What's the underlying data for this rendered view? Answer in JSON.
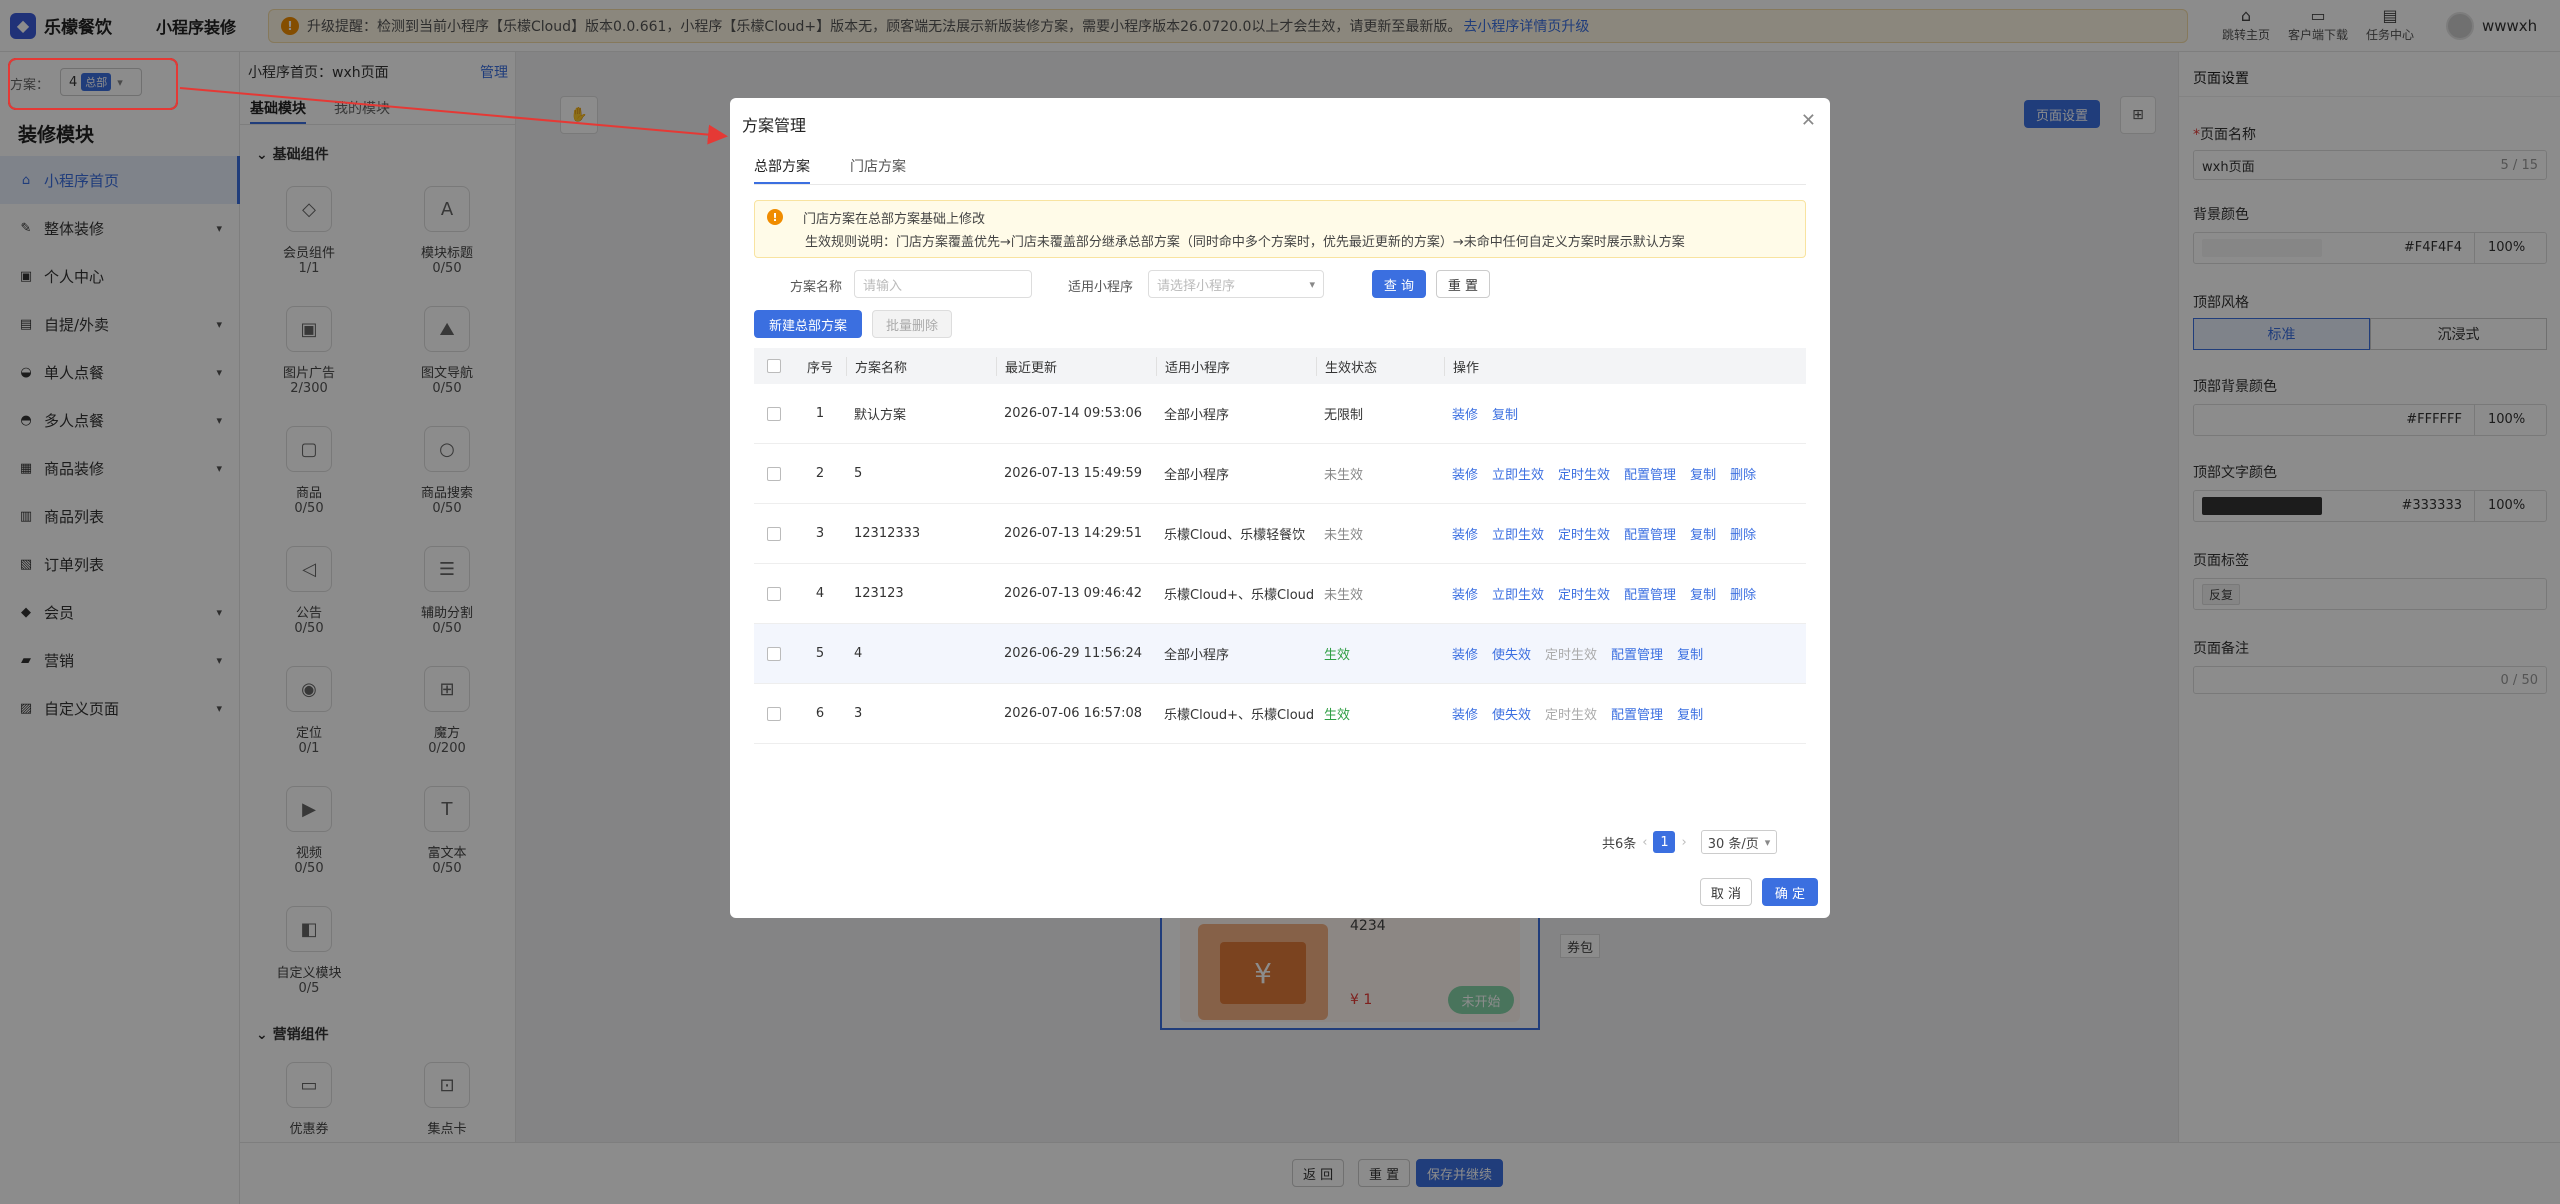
{
  "topbar": {
    "logo": "乐檬餐饮",
    "app_title": "小程序装修",
    "notice_text": "升级提醒：检测到当前小程序【乐檬Cloud】版本0.0.661，小程序【乐檬Cloud+】版本无，顾客端无法展示新版装修方案，需要小程序版本26.0720.0以上才会生效，请更新至最新版。",
    "notice_link": "去小程序详情页升级",
    "icons": [
      {
        "label": "跳转主页",
        "icon": "home-icon"
      },
      {
        "label": "客户端下载",
        "icon": "download-icon"
      },
      {
        "label": "任务中心",
        "icon": "task-icon"
      }
    ],
    "user_name": "wwwxh"
  },
  "sidebar": {
    "scheme_label": "方案：",
    "scheme_value": "4",
    "scheme_tag": "总部",
    "title": "装修模块",
    "items": [
      {
        "label": "小程序首页",
        "active": true,
        "has_children": false
      },
      {
        "label": "整体装修",
        "has_children": true
      },
      {
        "label": "个人中心",
        "has_children": false
      },
      {
        "label": "自提/外卖",
        "has_children": true
      },
      {
        "label": "单人点餐",
        "has_children": true
      },
      {
        "label": "多人点餐",
        "has_children": true
      },
      {
        "label": "商品装修",
        "has_children": true
      },
      {
        "label": "商品列表",
        "has_children": false
      },
      {
        "label": "订单列表",
        "has_children": false
      },
      {
        "label": "会员",
        "has_children": true
      },
      {
        "label": "营销",
        "has_children": true
      },
      {
        "label": "自定义页面",
        "has_children": true
      }
    ]
  },
  "components": {
    "page_label": "小程序首页：wxh页面",
    "manage": "管理",
    "tabs": [
      "基础模块",
      "我的模块"
    ],
    "group_basic": "基础组件",
    "group_marketing": "营销组件",
    "basic": [
      {
        "name": "会员组件",
        "count": "1/1"
      },
      {
        "name": "模块标题",
        "count": "0/50"
      },
      {
        "name": "图片广告",
        "count": "2/300"
      },
      {
        "name": "图文导航",
        "count": "0/50"
      },
      {
        "name": "商品",
        "count": "0/50"
      },
      {
        "name": "商品搜索",
        "count": "0/50"
      },
      {
        "name": "公告",
        "count": "0/50"
      },
      {
        "name": "辅助分割",
        "count": "0/50"
      },
      {
        "name": "定位",
        "count": "0/1"
      },
      {
        "name": "魔方",
        "count": "0/200"
      },
      {
        "name": "视频",
        "count": "0/50"
      },
      {
        "name": "富文本",
        "count": "0/50"
      },
      {
        "name": "自定义模块",
        "count": "0/5"
      }
    ],
    "marketing": [
      {
        "name": "优惠券"
      },
      {
        "name": "集点卡"
      }
    ]
  },
  "canvas": {
    "page_settings_btn": "页面设置",
    "coupon_num": "4234",
    "coupon_price": "¥ 1",
    "coupon_btn": "未开始",
    "coupon_tag": "券包"
  },
  "bottombar": {
    "back": "返 回",
    "reset": "重 置",
    "save": "保存并继续"
  },
  "right_panel": {
    "title": "页面设置",
    "page_name_label": "页面名称",
    "page_name_value": "wxh页面",
    "page_name_count": "5 / 15",
    "bg_color_label": "背景颜色",
    "bg_color_hex": "#F4F4F4",
    "bg_color_pct": "100%",
    "top_style_label": "顶部风格",
    "top_style_options": [
      "标准",
      "沉浸式"
    ],
    "top_bg_label": "顶部背景颜色",
    "top_bg_hex": "#FFFFFF",
    "top_bg_pct": "100%",
    "top_text_label": "顶部文字颜色",
    "top_text_hex": "#333333",
    "top_text_pct": "100%",
    "tag_label": "页面标签",
    "tag_value": "反复",
    "note_label": "页面备注",
    "note_count": "0 / 50"
  },
  "modal": {
    "title": "方案管理",
    "tabs": [
      "总部方案",
      "门店方案"
    ],
    "notice_l1": "门店方案在总部方案基础上修改",
    "notice_l2": "生效规则说明：门店方案覆盖优先→门店未覆盖部分继承总部方案（同时命中多个方案时，优先最近更新的方案）→未命中任何自定义方案时展示默认方案",
    "filter_name_label": "方案名称",
    "filter_name_placeholder": "请输入",
    "filter_app_label": "适用小程序",
    "filter_app_placeholder": "请选择小程序",
    "btn_query": "查 询",
    "btn_reset": "重 置",
    "btn_new": "新建总部方案",
    "btn_batch_delete": "批量删除",
    "columns": [
      "序号",
      "方案名称",
      "最近更新",
      "适用小程序",
      "生效状态",
      "操作"
    ],
    "rows": [
      {
        "no": "1",
        "name": "默认方案",
        "date": "2026-07-14 09:53:06",
        "app": "全部小程序",
        "status": "无限制",
        "status_kind": "none",
        "ops": [
          {
            "t": "装修"
          },
          {
            "t": "复制"
          }
        ]
      },
      {
        "no": "2",
        "name": "5",
        "date": "2026-07-13 15:49:59",
        "app": "全部小程序",
        "status": "未生效",
        "status_kind": "inactive",
        "ops": [
          {
            "t": "装修"
          },
          {
            "t": "立即生效"
          },
          {
            "t": "定时生效"
          },
          {
            "t": "配置管理"
          },
          {
            "t": "复制"
          },
          {
            "t": "删除"
          }
        ]
      },
      {
        "no": "3",
        "name": "12312333",
        "date": "2026-07-13 14:29:51",
        "app": "乐檬Cloud、乐檬轻餐饮",
        "status": "未生效",
        "status_kind": "inactive",
        "ops": [
          {
            "t": "装修"
          },
          {
            "t": "立即生效"
          },
          {
            "t": "定时生效"
          },
          {
            "t": "配置管理"
          },
          {
            "t": "复制"
          },
          {
            "t": "删除"
          }
        ]
      },
      {
        "no": "4",
        "name": "123123",
        "date": "2026-07-13 09:46:42",
        "app": "乐檬Cloud+、乐檬Cloud",
        "status": "未生效",
        "status_kind": "inactive",
        "ops": [
          {
            "t": "装修"
          },
          {
            "t": "立即生效"
          },
          {
            "t": "定时生效"
          },
          {
            "t": "配置管理"
          },
          {
            "t": "复制"
          },
          {
            "t": "删除"
          }
        ]
      },
      {
        "no": "5",
        "name": "4",
        "date": "2026-06-29 11:56:24",
        "app": "全部小程序",
        "status": "生效",
        "status_kind": "active",
        "ops": [
          {
            "t": "装修"
          },
          {
            "t": "使失效"
          },
          {
            "t": "定时生效",
            "disabled": true
          },
          {
            "t": "配置管理"
          },
          {
            "t": "复制"
          }
        ]
      },
      {
        "no": "6",
        "name": "3",
        "date": "2026-07-06 16:57:08",
        "app": "乐檬Cloud+、乐檬Cloud",
        "status": "生效",
        "status_kind": "active",
        "ops": [
          {
            "t": "装修"
          },
          {
            "t": "使失效"
          },
          {
            "t": "定时生效",
            "disabled": true
          },
          {
            "t": "配置管理"
          },
          {
            "t": "复制"
          }
        ]
      }
    ],
    "total": "共6条",
    "page": "1",
    "page_size": "30 条/页",
    "btn_cancel": "取 消",
    "btn_ok": "确 定"
  },
  "colors": {
    "primary": "#3b6fe0",
    "active_status": "#2f9e44",
    "highlight_border": "#e53935"
  }
}
